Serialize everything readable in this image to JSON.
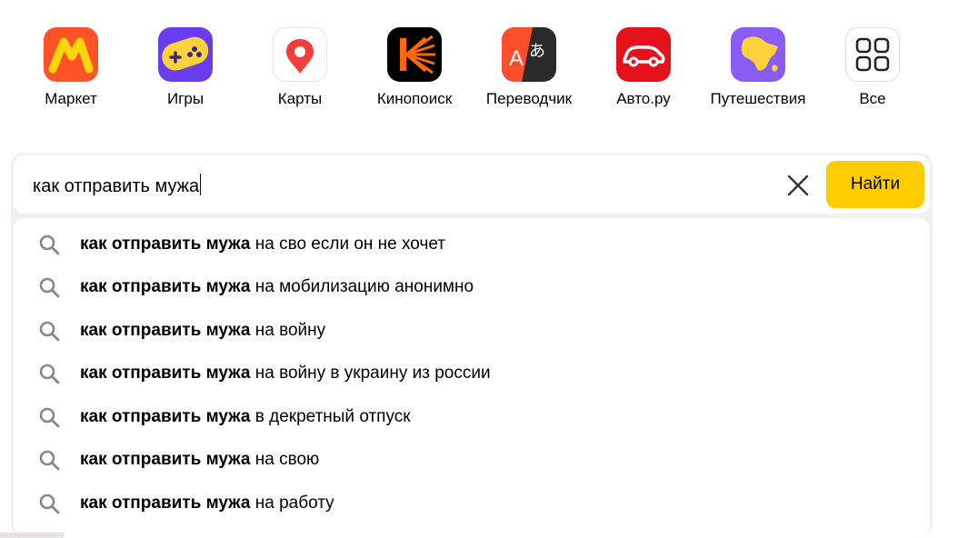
{
  "services": [
    {
      "label": "Маркет",
      "icon": "market-icon"
    },
    {
      "label": "Игры",
      "icon": "games-icon"
    },
    {
      "label": "Карты",
      "icon": "maps-icon"
    },
    {
      "label": "Кинопоиск",
      "icon": "kinopoisk-icon"
    },
    {
      "label": "Переводчик",
      "icon": "translator-icon"
    },
    {
      "label": "Авто.ру",
      "icon": "autoru-icon"
    },
    {
      "label": "Путешествия",
      "icon": "travel-icon"
    },
    {
      "label": "Все",
      "icon": "all-services-icon"
    }
  ],
  "search": {
    "query": "как отправить мужа",
    "button_label": "Найти",
    "button_color": "#ffcc00"
  },
  "suggestions": [
    {
      "bold": "как отправить мужа",
      "rest": " на сво если он не хочет"
    },
    {
      "bold": "как отправить мужа",
      "rest": " на мобилизацию анонимно"
    },
    {
      "bold": "как отправить мужа",
      "rest": " на войну"
    },
    {
      "bold": "как отправить мужа",
      "rest": " на войну в украину из россии"
    },
    {
      "bold": "как отправить мужа",
      "rest": " в декретный отпуск"
    },
    {
      "bold": "как отправить мужа",
      "rest": " на свою"
    },
    {
      "bold": "как отправить мужа",
      "rest": " на работу"
    }
  ]
}
